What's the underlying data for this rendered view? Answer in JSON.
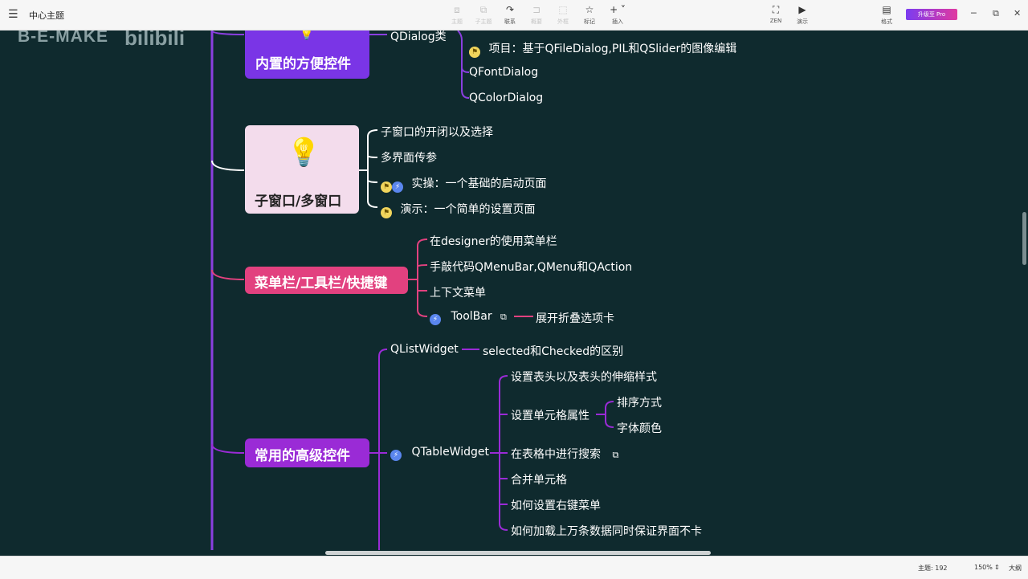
{
  "app": {
    "doc_title": "中心主题",
    "toolbar": [
      {
        "icon": "topic-icon",
        "label": "主题",
        "disabled": true
      },
      {
        "icon": "subtopic-icon",
        "label": "子主题",
        "disabled": true
      },
      {
        "icon": "relation-icon",
        "label": "联系",
        "disabled": false
      },
      {
        "icon": "summary-icon",
        "label": "概要",
        "disabled": true
      },
      {
        "icon": "boundary-icon",
        "label": "外框",
        "disabled": true
      },
      {
        "icon": "marker-icon",
        "label": "标记",
        "disabled": false
      },
      {
        "icon": "insert-icon",
        "label": "插入",
        "disabled": false
      }
    ],
    "zen_label": "ZEN",
    "present_label": "演示",
    "format_label": "格式",
    "pro_button": "升级至 Pro",
    "glyphs": {
      "menu": "☰",
      "minimize": "─",
      "restore": "⧉",
      "close": "✕",
      "topic": "⧈",
      "subtopic": "⧉",
      "relation": "↷",
      "summary": "⊐",
      "boundary": "⬚",
      "marker": "☆",
      "insert": "+ ˅",
      "zen": "⛶",
      "present": "▶",
      "format": "▤",
      "flag": "⚑",
      "bolt": "⚡",
      "ext": "⧉",
      "bulb": "💡"
    }
  },
  "watermark": {
    "text": "B-E-MAKE",
    "brand": "bilibili"
  },
  "mindmap": {
    "t1": {
      "label": "内置的方便控件",
      "child": "QDialog类",
      "items": [
        "项目：基于QFileDialog,PIL和QSlider的图像编辑",
        "QFontDialog",
        "QColorDialog"
      ]
    },
    "t2": {
      "label": "子窗口/多窗口",
      "items": [
        "子窗口的开闭以及选择",
        "多界面传参",
        "实操：一个基础的启动页面",
        "演示：一个简单的设置页面"
      ]
    },
    "t3": {
      "label": "菜单栏/工具栏/快捷键",
      "items": [
        "在designer的使用菜单栏",
        "手敲代码QMenuBar,QMenu和QAction",
        "上下文菜单",
        "ToolBar"
      ],
      "toolbar_child": "展开折叠选项卡"
    },
    "t4": {
      "label": "常用的高级控件",
      "list_widget": "QListWidget",
      "list_child": "selected和Checked的区别",
      "table_widget": "QTableWidget",
      "table_items": [
        "设置表头以及表头的伸缩样式",
        "设置单元格属性",
        "在表格中进行搜索",
        "合并单元格",
        "如何设置右键菜单",
        "如何加载上万条数据同时保证界面不卡"
      ],
      "cell_children": [
        "排序方式",
        "字体颜色"
      ]
    }
  },
  "colors": {
    "bg": "#0f2a2e",
    "main_line": "#8a3fe0",
    "white_line": "#ffffff",
    "pink": "#e2417f",
    "purple": "#9a2bd6"
  },
  "status": {
    "topic_count": "主题: 192",
    "zoom": "150%",
    "mode": "大纲"
  }
}
